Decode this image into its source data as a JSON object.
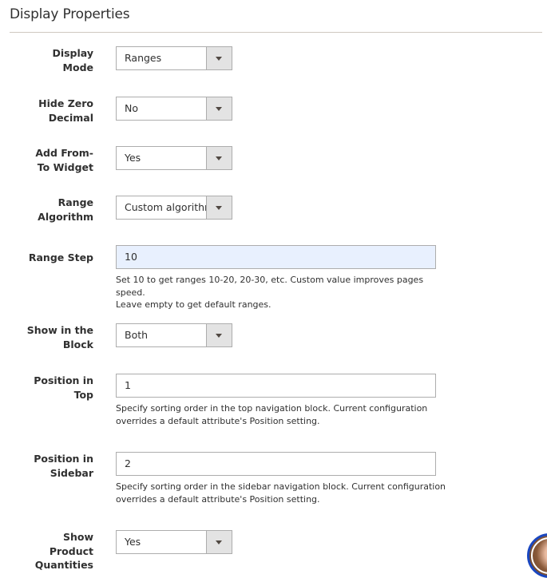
{
  "section": {
    "title": "Display Properties"
  },
  "fields": {
    "display_mode": {
      "label": "Display Mode",
      "label_lines": [
        "Display",
        "Mode"
      ],
      "value": "Ranges"
    },
    "hide_zero_decimal": {
      "label_lines": [
        "Hide Zero",
        "Decimal"
      ],
      "value": "No"
    },
    "add_from_to_widget": {
      "label_lines": [
        "Add From-",
        "To Widget"
      ],
      "value": "Yes"
    },
    "range_algorithm": {
      "label_lines": [
        "Range",
        "Algorithm"
      ],
      "value": "Custom algorithm"
    },
    "range_step": {
      "label": "Range Step",
      "value": "10",
      "note_lines": [
        "Set 10 to get ranges 10-20, 20-30, etc. Custom value improves pages speed.",
        "Leave empty to get default ranges."
      ]
    },
    "show_in_block": {
      "label_lines": [
        "Show in the",
        "Block"
      ],
      "value": "Both"
    },
    "position_in_top": {
      "label_lines": [
        "Position in",
        "Top"
      ],
      "value": "1",
      "note_lines": [
        "Specify sorting order in the top navigation block. Current configuration",
        "overrides a default attribute's Position setting."
      ]
    },
    "position_in_sidebar": {
      "label_lines": [
        "Position in",
        "Sidebar"
      ],
      "value": "2",
      "note_lines": [
        "Specify sorting order in the sidebar navigation block. Current configuration",
        "overrides a default attribute's Position setting."
      ]
    },
    "show_product_quantities": {
      "label_lines": [
        "Show",
        "Product",
        "Quantities"
      ],
      "value": "Yes"
    }
  },
  "icons": {
    "dropdown": "chevron-down-icon",
    "avatar": "user-avatar"
  }
}
